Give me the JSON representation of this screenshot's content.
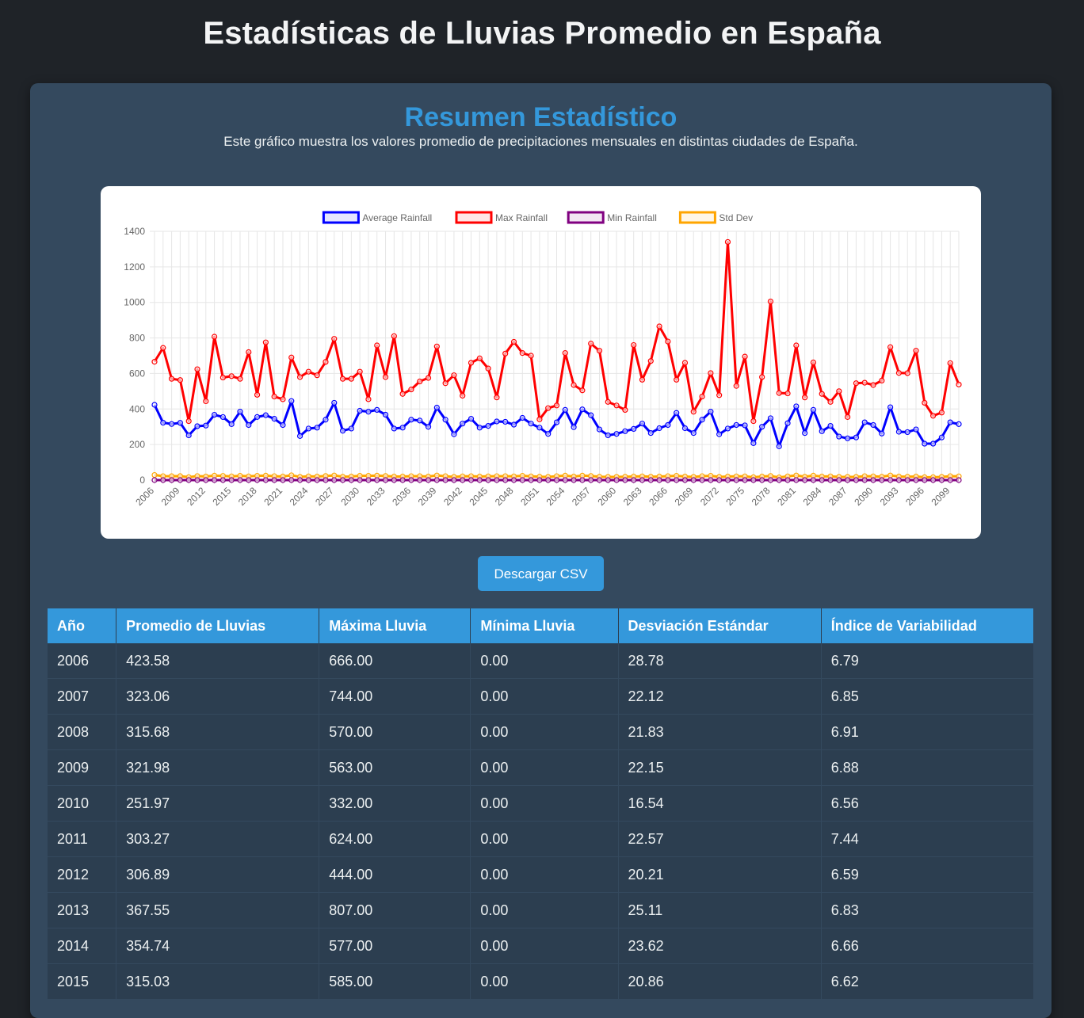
{
  "page": {
    "title": "Estadísticas de Lluvias Promedio en España",
    "section_title": "Resumen Estadístico",
    "description": "Este gráfico muestra los valores promedio de precipitaciones mensuales en distintas ciudades de España.",
    "download_button": "Descargar CSV"
  },
  "colors": {
    "background": "#1f2328",
    "panel": "#34495e",
    "accent": "#3498db",
    "table_row": "#2c3e50"
  },
  "chart_data": {
    "type": "line",
    "title": "",
    "xlabel": "",
    "ylabel": "",
    "ylim": [
      0,
      1400
    ],
    "yticks": [
      0,
      200,
      400,
      600,
      800,
      1000,
      1200,
      1400
    ],
    "grid": true,
    "legend_position": "top",
    "x": [
      2006,
      2007,
      2008,
      2009,
      2010,
      2011,
      2012,
      2013,
      2014,
      2015,
      2016,
      2017,
      2018,
      2019,
      2020,
      2021,
      2022,
      2023,
      2024,
      2025,
      2026,
      2027,
      2028,
      2029,
      2030,
      2031,
      2032,
      2033,
      2034,
      2035,
      2036,
      2037,
      2038,
      2039,
      2040,
      2041,
      2042,
      2043,
      2044,
      2045,
      2046,
      2047,
      2048,
      2049,
      2050,
      2051,
      2052,
      2053,
      2054,
      2055,
      2056,
      2057,
      2058,
      2059,
      2060,
      2061,
      2062,
      2063,
      2064,
      2065,
      2066,
      2067,
      2068,
      2069,
      2070,
      2071,
      2072,
      2073,
      2074,
      2075,
      2076,
      2077,
      2078,
      2079,
      2080,
      2081,
      2082,
      2083,
      2084,
      2085,
      2086,
      2087,
      2088,
      2089,
      2090,
      2091,
      2092,
      2093,
      2094,
      2095,
      2096,
      2097,
      2098,
      2099,
      2100
    ],
    "x_tick_labels": [
      "2006",
      "2009",
      "2012",
      "2015",
      "2018",
      "2021",
      "2024",
      "2027",
      "2030",
      "2033",
      "2036",
      "2039",
      "2042",
      "2045",
      "2048",
      "2051",
      "2054",
      "2057",
      "2060",
      "2063",
      "2066",
      "2069",
      "2072",
      "2075",
      "2078",
      "2081",
      "2084",
      "2087",
      "2090",
      "2093",
      "2096",
      "2099"
    ],
    "series": [
      {
        "name": "Average Rainfall",
        "color": "#0000ff",
        "values": [
          423.58,
          323.06,
          315.68,
          321.98,
          251.97,
          303.27,
          306.89,
          367.55,
          354.74,
          315.03,
          385,
          310,
          355,
          365,
          345,
          310,
          445,
          248,
          290,
          295,
          340,
          435,
          278,
          290,
          390,
          385,
          395,
          368,
          290,
          295,
          340,
          335,
          300,
          408,
          340,
          258,
          318,
          345,
          295,
          305,
          330,
          328,
          312,
          350,
          318,
          295,
          260,
          325,
          395,
          298,
          398,
          365,
          285,
          252,
          260,
          275,
          288,
          318,
          265,
          292,
          310,
          378,
          292,
          265,
          340,
          385,
          258,
          290,
          310,
          308,
          208,
          300,
          348,
          190,
          320,
          415,
          265,
          395,
          275,
          305,
          245,
          235,
          240,
          325,
          310,
          262,
          410,
          272,
          270,
          285,
          205,
          205,
          240,
          325,
          315
        ]
      },
      {
        "name": "Max Rainfall",
        "color": "#ff0000",
        "values": [
          666,
          744,
          570,
          563,
          332,
          624,
          444,
          807,
          577,
          585,
          570,
          720,
          480,
          775,
          470,
          455,
          690,
          580,
          610,
          590,
          665,
          795,
          570,
          570,
          610,
          455,
          758,
          580,
          810,
          485,
          510,
          555,
          575,
          752,
          545,
          590,
          475,
          660,
          685,
          628,
          465,
          712,
          778,
          715,
          700,
          342,
          405,
          420,
          715,
          535,
          505,
          768,
          728,
          440,
          420,
          395,
          760,
          565,
          670,
          865,
          780,
          565,
          660,
          385,
          470,
          602,
          478,
          1340,
          530,
          695,
          332,
          580,
          1005,
          490,
          488,
          758,
          465,
          662,
          485,
          440,
          500,
          355,
          545,
          548,
          535,
          560,
          748,
          603,
          602,
          728,
          435,
          362,
          380,
          658,
          538
        ]
      },
      {
        "name": "Min Rainfall",
        "color": "#800080",
        "values": [
          0,
          0,
          0,
          0,
          0,
          0,
          0,
          0,
          0,
          0,
          0,
          0,
          0,
          0,
          0,
          0,
          0,
          0,
          0,
          0,
          0,
          0,
          0,
          0,
          0,
          0,
          0,
          0,
          0,
          0,
          0,
          0,
          0,
          0,
          0,
          0,
          0,
          0,
          0,
          0,
          0,
          0,
          0,
          0,
          0,
          0,
          0,
          0,
          0,
          0,
          0,
          0,
          0,
          0,
          0,
          0,
          0,
          0,
          0,
          0,
          0,
          0,
          0,
          0,
          0,
          0,
          0,
          0,
          0,
          0,
          0,
          0,
          0,
          0,
          0,
          0,
          0,
          0,
          0,
          0,
          0,
          0,
          0,
          0,
          0,
          0,
          0,
          0,
          0,
          0,
          0,
          0,
          0,
          0,
          0
        ]
      },
      {
        "name": "Std Dev",
        "color": "#ffa500",
        "values": [
          28.78,
          22.12,
          21.83,
          22.15,
          16.54,
          22.57,
          20.21,
          25.11,
          23.62,
          20.86,
          24,
          21,
          24,
          25,
          22,
          20,
          27,
          18,
          21,
          20,
          23,
          26,
          19,
          20,
          24,
          24,
          25,
          23,
          20,
          20,
          22,
          22,
          20,
          26,
          22,
          18,
          21,
          22,
          20,
          21,
          22,
          22,
          21,
          24,
          21,
          19,
          18,
          22,
          25,
          20,
          25,
          23,
          19,
          18,
          18,
          19,
          20,
          21,
          19,
          20,
          22,
          24,
          20,
          18,
          22,
          24,
          18,
          20,
          21,
          21,
          16,
          20,
          23,
          15,
          21,
          26,
          19,
          25,
          20,
          21,
          18,
          18,
          18,
          22,
          21,
          19,
          26,
          20,
          19,
          20,
          16,
          16,
          18,
          22,
          21
        ]
      }
    ]
  },
  "table": {
    "headers": [
      "Año",
      "Promedio de Lluvias",
      "Máxima Lluvia",
      "Mínima Lluvia",
      "Desviación Estándar",
      "Índice de Variabilidad"
    ],
    "rows": [
      [
        "2006",
        "423.58",
        "666.00",
        "0.00",
        "28.78",
        "6.79"
      ],
      [
        "2007",
        "323.06",
        "744.00",
        "0.00",
        "22.12",
        "6.85"
      ],
      [
        "2008",
        "315.68",
        "570.00",
        "0.00",
        "21.83",
        "6.91"
      ],
      [
        "2009",
        "321.98",
        "563.00",
        "0.00",
        "22.15",
        "6.88"
      ],
      [
        "2010",
        "251.97",
        "332.00",
        "0.00",
        "16.54",
        "6.56"
      ],
      [
        "2011",
        "303.27",
        "624.00",
        "0.00",
        "22.57",
        "7.44"
      ],
      [
        "2012",
        "306.89",
        "444.00",
        "0.00",
        "20.21",
        "6.59"
      ],
      [
        "2013",
        "367.55",
        "807.00",
        "0.00",
        "25.11",
        "6.83"
      ],
      [
        "2014",
        "354.74",
        "577.00",
        "0.00",
        "23.62",
        "6.66"
      ],
      [
        "2015",
        "315.03",
        "585.00",
        "0.00",
        "20.86",
        "6.62"
      ]
    ]
  }
}
